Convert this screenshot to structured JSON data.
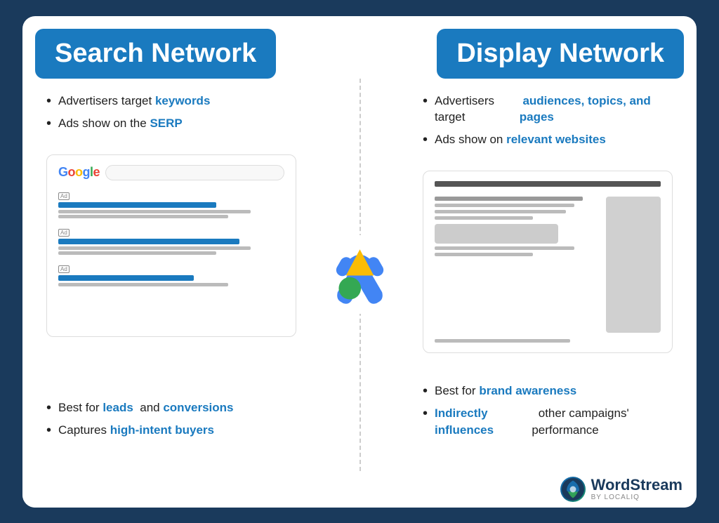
{
  "card": {
    "left_header": "Search Network",
    "right_header": "Display Network"
  },
  "left": {
    "bullets_top": [
      {
        "text": "Advertisers target ",
        "highlight": "keywords",
        "highlight_after": ""
      },
      {
        "text": "Ads show on the ",
        "highlight": "SERP",
        "highlight_after": ""
      }
    ],
    "bullets_bottom": [
      {
        "text": "Best for ",
        "highlight": "leads",
        "mid": " and ",
        "highlight2": "conversions",
        "after": ""
      },
      {
        "text": "Captures ",
        "highlight": "high-intent buyers",
        "after": ""
      }
    ]
  },
  "right": {
    "bullets_top": [
      {
        "text": "Advertisers target ",
        "highlight": "audiences, topics, and pages",
        "after": ""
      },
      {
        "text": "Ads show on ",
        "highlight": "relevant websites",
        "after": ""
      }
    ],
    "bullets_bottom": [
      {
        "text": "Best for ",
        "highlight": "brand awareness",
        "after": ""
      },
      {
        "text_highlight": "Indirectly influences",
        "text_rest": " other campaigns' performance"
      }
    ]
  },
  "footer": {
    "brand": "WordStream",
    "sub": "By LOCALiQ"
  }
}
